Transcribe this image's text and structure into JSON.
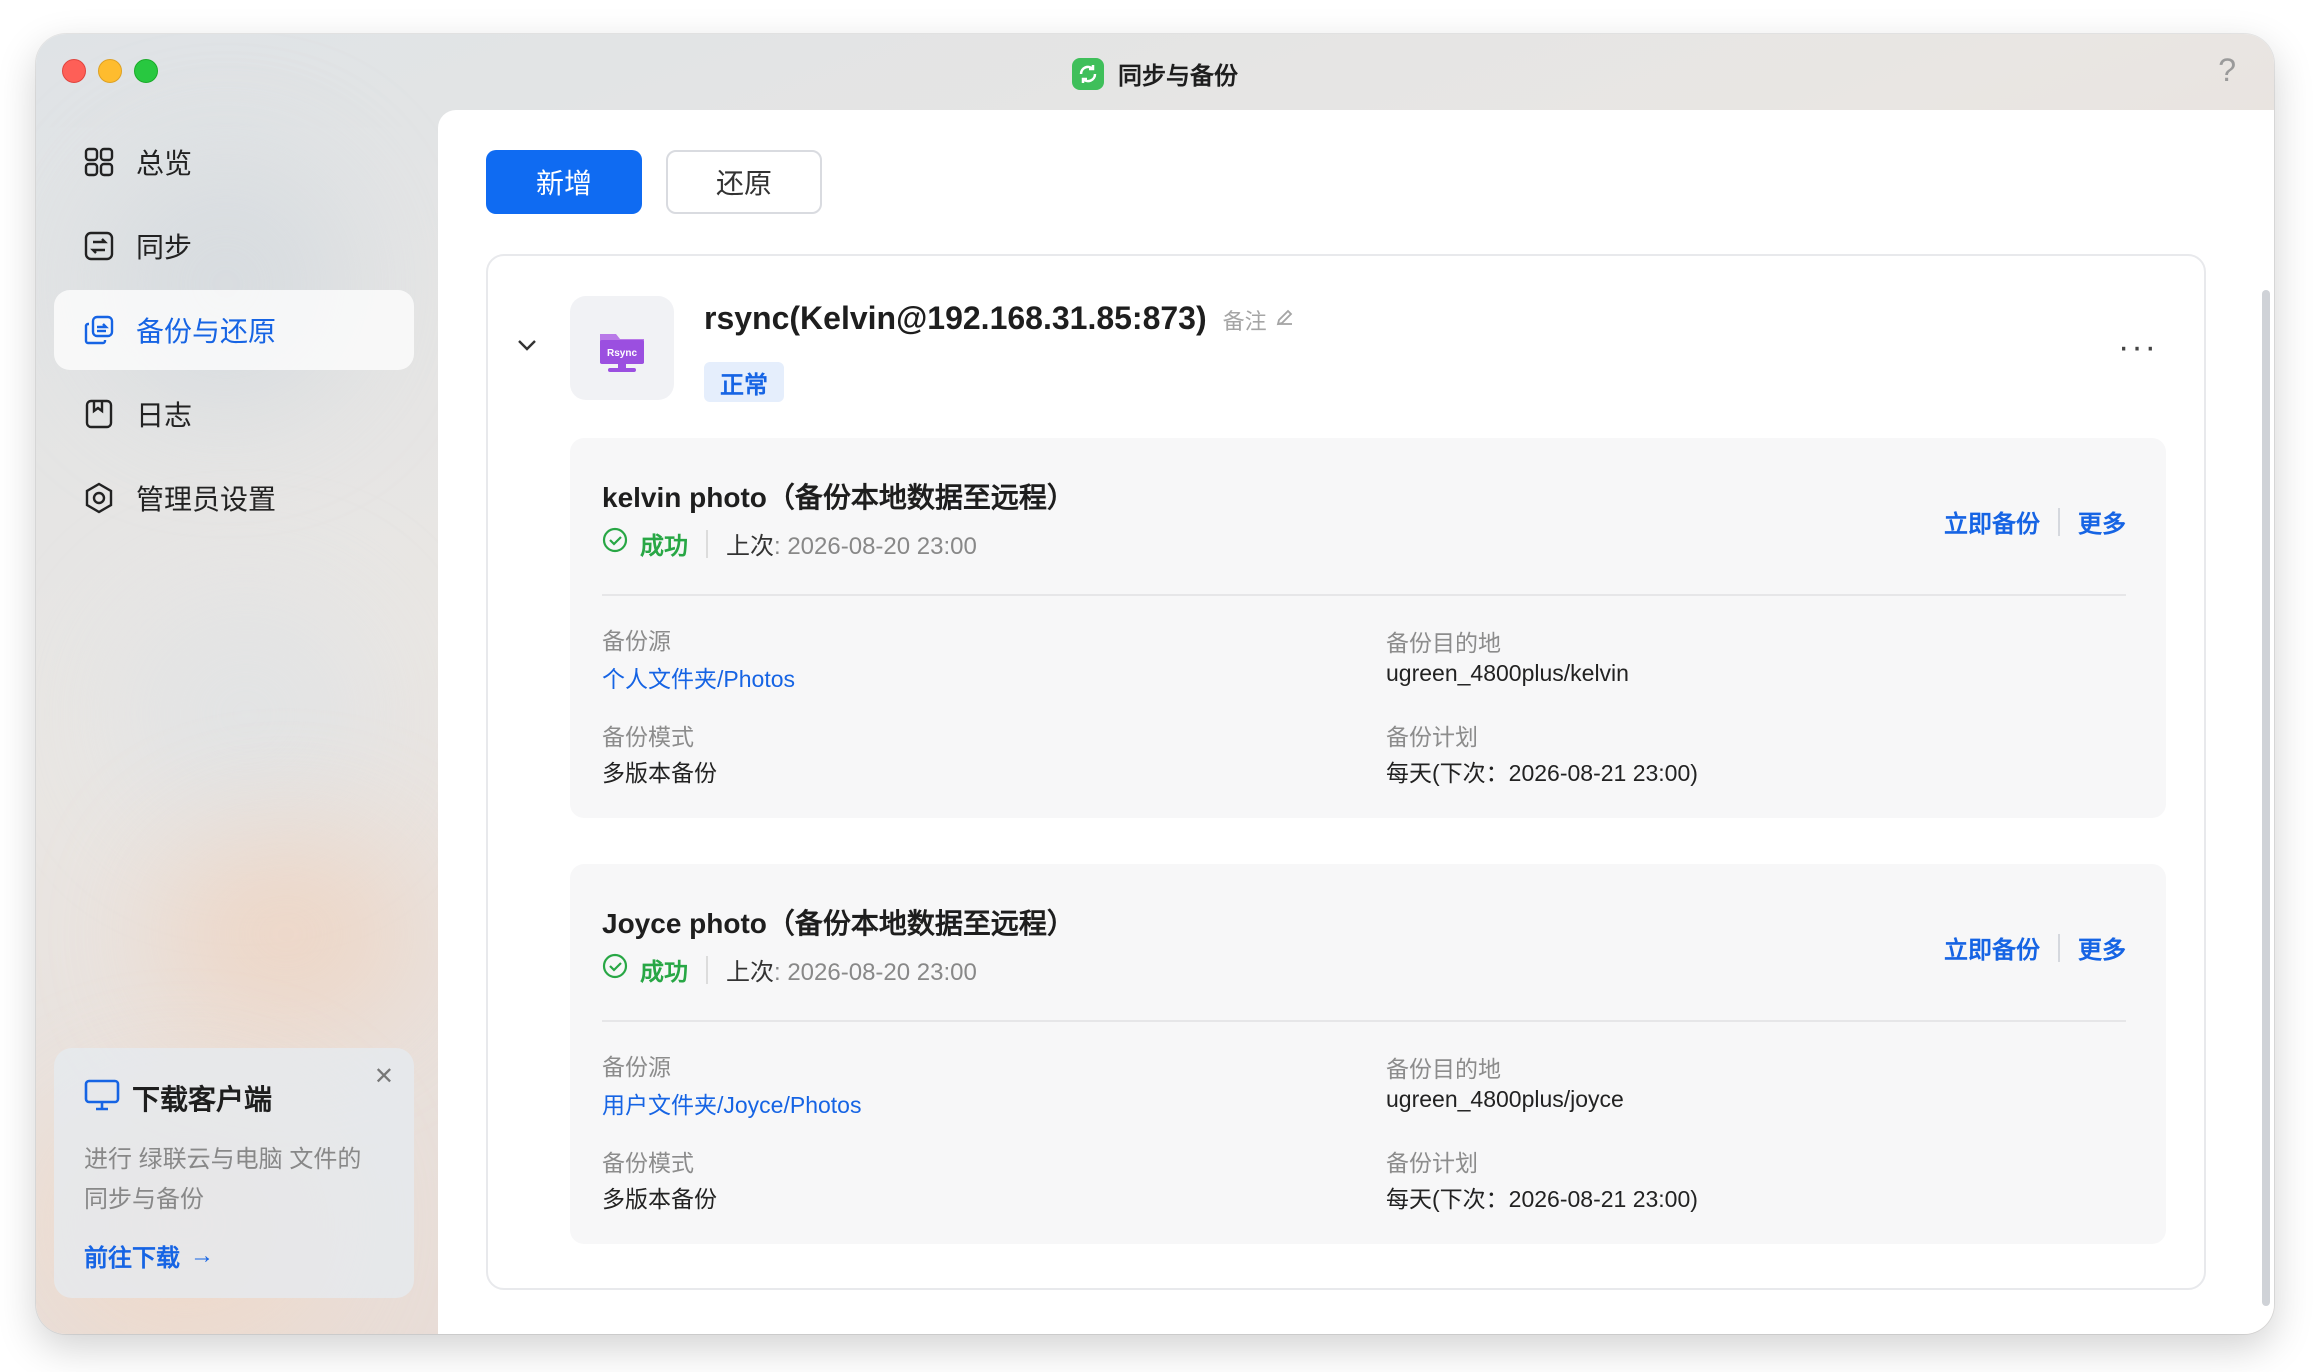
{
  "window": {
    "title": "同步与备份",
    "help": "?"
  },
  "sidebar": {
    "items": [
      {
        "label": "总览",
        "icon": "grid-icon"
      },
      {
        "label": "同步",
        "icon": "sync-icon"
      },
      {
        "label": "备份与还原",
        "icon": "backup-restore-icon",
        "active": true
      },
      {
        "label": "日志",
        "icon": "log-icon"
      },
      {
        "label": "管理员设置",
        "icon": "admin-settings-icon"
      }
    ]
  },
  "promo": {
    "title": "下载客户端",
    "desc": "进行 绿联云与电脑 文件的同步与备份",
    "link": "前往下载"
  },
  "toolbar": {
    "add_label": "新增",
    "restore_label": "还原"
  },
  "task": {
    "title": "rsync(Kelvin@192.168.31.85:873)",
    "note": "备注",
    "status": "正常",
    "tile_text": "Rsync",
    "menu": "···"
  },
  "jobs": [
    {
      "name": "kelvin photo（备份本地数据至远程）",
      "status": "成功",
      "last_label": "上次",
      "last_value": ": 2026-08-20 23:00",
      "action_backup": "立即备份",
      "action_more": "更多",
      "source_label": "备份源",
      "source_value": "个人文件夹/Photos",
      "dest_label": "备份目的地",
      "dest_value": "ugreen_4800plus/kelvin",
      "mode_label": "备份模式",
      "mode_value": "多版本备份",
      "plan_label": "备份计划",
      "plan_value": "每天(下次：2026-08-21 23:00)"
    },
    {
      "name": "Joyce photo（备份本地数据至远程）",
      "status": "成功",
      "last_label": "上次",
      "last_value": ": 2026-08-20 23:00",
      "action_backup": "立即备份",
      "action_more": "更多",
      "source_label": "备份源",
      "source_value": "用户文件夹/Joyce/Photos",
      "dest_label": "备份目的地",
      "dest_value": "ugreen_4800plus/joyce",
      "mode_label": "备份模式",
      "mode_value": "多版本备份",
      "plan_label": "备份计划",
      "plan_value": "每天(下次：2026-08-21 23:00)"
    }
  ],
  "colors": {
    "accent": "#1664e4",
    "primary_button": "#0f6bf2",
    "success": "#28a745"
  }
}
